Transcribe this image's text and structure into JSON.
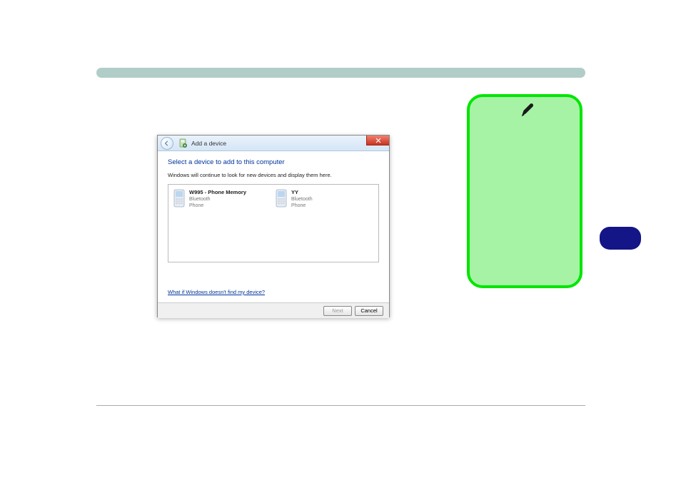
{
  "dialog": {
    "title": "Add a device",
    "heading": "Select a device to add to this computer",
    "subtext": "Windows will continue to look for new devices and display them here.",
    "help_link": "What if Windows doesn't find my device?",
    "devices": [
      {
        "name": "W995 - Phone Memory",
        "type": "Bluetooth",
        "category": "Phone"
      },
      {
        "name": "YY",
        "type": "Bluetooth",
        "category": "Phone"
      }
    ],
    "buttons": {
      "next": "Next",
      "cancel": "Cancel"
    }
  }
}
